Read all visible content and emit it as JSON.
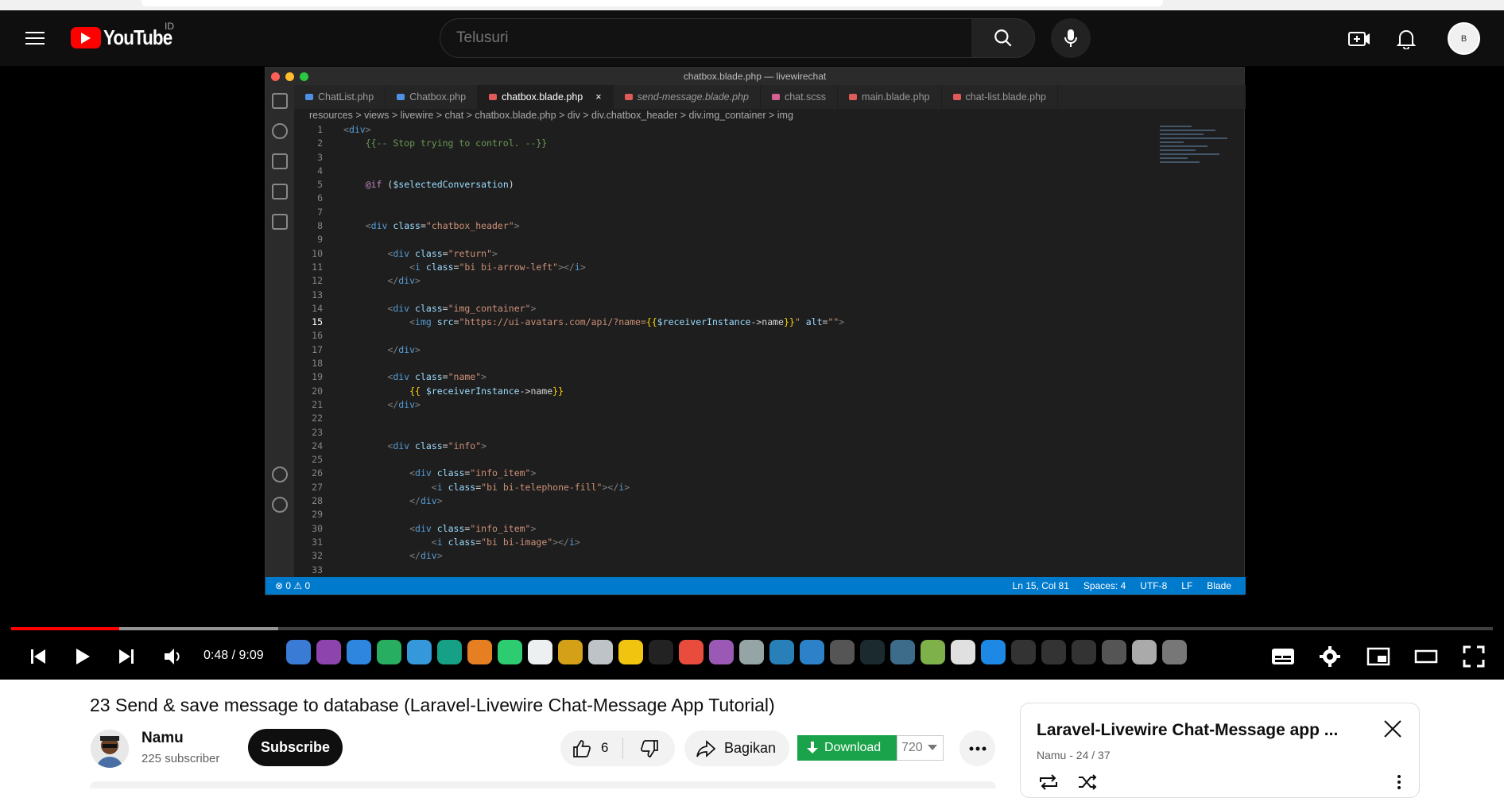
{
  "masthead": {
    "logo_text": "YouTube",
    "country_code": "ID",
    "search_placeholder": "Telusuri",
    "avatar_text": "B"
  },
  "video_frame": {
    "window_title": "chatbox.blade.php — livewirechat",
    "tabs": [
      {
        "label": "ChatList.php",
        "color": "#4f8fe6"
      },
      {
        "label": "Chatbox.php",
        "color": "#4f8fe6"
      },
      {
        "label": "chatbox.blade.php",
        "color": "#e05a5a",
        "active": true
      },
      {
        "label": "send-message.blade.php",
        "color": "#e05a5a",
        "italic": true
      },
      {
        "label": "chat.scss",
        "color": "#d6608f"
      },
      {
        "label": "main.blade.php",
        "color": "#e05a5a"
      },
      {
        "label": "chat-list.blade.php",
        "color": "#e05a5a"
      }
    ],
    "breadcrumb": "resources > views > livewire > chat > chatbox.blade.php > div > div.chatbox_header > div.img_container > img",
    "status_left": "⊗ 0 ⚠ 0",
    "status_right": [
      "Ln 15, Col 81",
      "Spaces: 4",
      "UTF-8",
      "LF",
      "Blade"
    ]
  },
  "player": {
    "time": "0:48 / 9:09",
    "progress_played": 0.073,
    "progress_loaded": 0.18
  },
  "video": {
    "title": "23 Send & save message to database (Laravel-Livewire Chat-Message App Tutorial)",
    "channel_name": "Namu",
    "subscribers": "225 subscriber",
    "subscribe_label": "Subscribe",
    "likes": "6",
    "share_label": "Bagikan",
    "download_label": "Download",
    "quality": "720"
  },
  "playlist": {
    "title": "Laravel-Livewire Chat-Message app ...",
    "subtitle": "Namu - 24 / 37"
  },
  "colors": {
    "accent_red": "#ff0000",
    "download_green": "#1aa34a",
    "vscode_status": "#007acc"
  }
}
